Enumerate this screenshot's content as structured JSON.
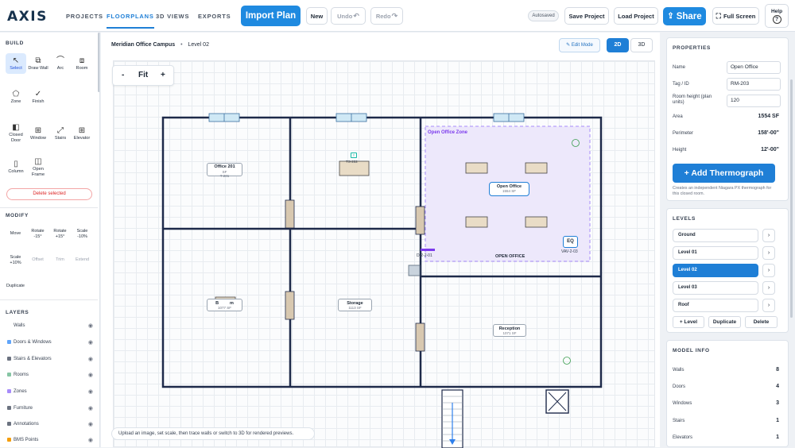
{
  "app": {
    "logo": "AXIS"
  },
  "nav": [
    {
      "label": "PROJECTS",
      "active": false
    },
    {
      "label": "FLOORPLANS",
      "active": true
    },
    {
      "label": "3D VIEWS",
      "active": false
    },
    {
      "label": "EXPORTS",
      "active": false
    }
  ],
  "toolbar": {
    "import_plan": "Import Plan",
    "new": "New",
    "undo": "Undo",
    "redo": "Redo",
    "autosaved": "Autosaved",
    "save_project": "Save Project",
    "load_project": "Load Project",
    "share": "Share",
    "full_screen": "Full Screen",
    "help": "Help",
    "help_icon": "?"
  },
  "left": {
    "build_title": "BUILD",
    "tools": [
      {
        "label": "Select",
        "icon": "↖"
      },
      {
        "label": "Draw Wall",
        "icon": "⧉"
      },
      {
        "label": "Arc",
        "icon": "⌒"
      },
      {
        "label": "Room",
        "icon": "⧈"
      },
      {
        "label": "Zone",
        "icon": "⬠"
      },
      {
        "label": "Finish",
        "icon": "✓"
      },
      {
        "label": "Closed Door",
        "icon": "◧"
      },
      {
        "label": "Window",
        "icon": "⊞"
      },
      {
        "label": "Stairs",
        "icon": "⤢"
      },
      {
        "label": "Elevator",
        "icon": "⊞"
      },
      {
        "label": "Column",
        "icon": "▯"
      },
      {
        "label": "Open Frame",
        "icon": "◫"
      }
    ],
    "delete_selected": "Delete selected",
    "modify_title": "MODIFY",
    "modify": [
      {
        "label": "Move",
        "dim": false
      },
      {
        "label": "Rotate -15°",
        "dim": false
      },
      {
        "label": "Rotate +15°",
        "dim": false
      },
      {
        "label": "Scale -10%",
        "dim": false
      },
      {
        "label": "Scale +10%",
        "dim": false
      },
      {
        "label": "Offset",
        "dim": true
      },
      {
        "label": "Trim",
        "dim": true
      },
      {
        "label": "Extend",
        "dim": true
      },
      {
        "label": "Duplicate",
        "dim": false
      }
    ],
    "layers_title": "LAYERS",
    "layers": [
      {
        "label": "Walls",
        "color": ""
      },
      {
        "label": "Doors & Windows",
        "color": "#60a5fa"
      },
      {
        "label": "Stairs & Elevators",
        "color": "#6b7280"
      },
      {
        "label": "Rooms",
        "color": "#86c5a4"
      },
      {
        "label": "Zones",
        "color": "#a78bfa"
      },
      {
        "label": "Furniture",
        "color": "#6b7280"
      },
      {
        "label": "Annotations",
        "color": "#6b7280"
      },
      {
        "label": "BMS Points",
        "color": "#f59e0b"
      }
    ],
    "eye_icon": "◉"
  },
  "canvas": {
    "project": "Meridian Office Campus",
    "separator": "•",
    "level": "Level 02",
    "edit_mode": "Edit Mode",
    "view_2d": "2D",
    "view_3d": "3D",
    "zoom_out": "-",
    "fit": "Fit",
    "zoom_in": "+",
    "hint": "Upload an image, set scale, then trace walls or switch to 3D for rendered previews.",
    "zone_label": "Open Office Zone",
    "open_office_text": "OPEN OFFICE",
    "rooms": {
      "office201": {
        "name": "Office 201",
        "area": "SF",
        "tag": "T-201"
      },
      "open_office": {
        "name": "Open Office",
        "area": "1554 SF"
      },
      "b_room": {
        "name": "B",
        "suffix": "m",
        "area": "1077 SF"
      },
      "storage": {
        "name": "Storage",
        "area": "1113 SF"
      },
      "reception": {
        "name": "Reception",
        "area": "1071 SF"
      }
    },
    "equipment": {
      "eq": "EQ",
      "vav": "VAV-2-03",
      "ts": "TS-202",
      "ts_icon": "T",
      "damper": "D-2-2-01"
    }
  },
  "properties": {
    "title": "PROPERTIES",
    "name_label": "Name",
    "name_value": "Open Office",
    "tag_label": "Tag / ID",
    "tag_value": "RM-203",
    "height_label": "Room height (plan units)",
    "height_value": "120",
    "area_label": "Area",
    "area_value": "1554 SF",
    "perimeter_label": "Perimeter",
    "perimeter_value": "158'-00\"",
    "height2_label": "Height",
    "height2_value": "12'-00\"",
    "thermo_btn": "+ Add Thermograph",
    "thermo_note": "Creates an independent Niagara PX thermograph for this closed room."
  },
  "levels": {
    "title": "LEVELS",
    "items": [
      {
        "label": "Ground",
        "active": false
      },
      {
        "label": "Level 01",
        "active": false
      },
      {
        "label": "Level 02",
        "active": true
      },
      {
        "label": "Level 03",
        "active": false
      },
      {
        "label": "Roof",
        "active": false
      }
    ],
    "go_icon": "›",
    "add": "+ Level",
    "duplicate": "Duplicate",
    "delete": "Delete"
  },
  "model_info": {
    "title": "MODEL INFO",
    "rows": [
      {
        "label": "Walls",
        "value": "8"
      },
      {
        "label": "Doors",
        "value": "4"
      },
      {
        "label": "Windows",
        "value": "3"
      },
      {
        "label": "Stairs",
        "value": "1"
      },
      {
        "label": "Elevators",
        "value": "1"
      }
    ]
  }
}
